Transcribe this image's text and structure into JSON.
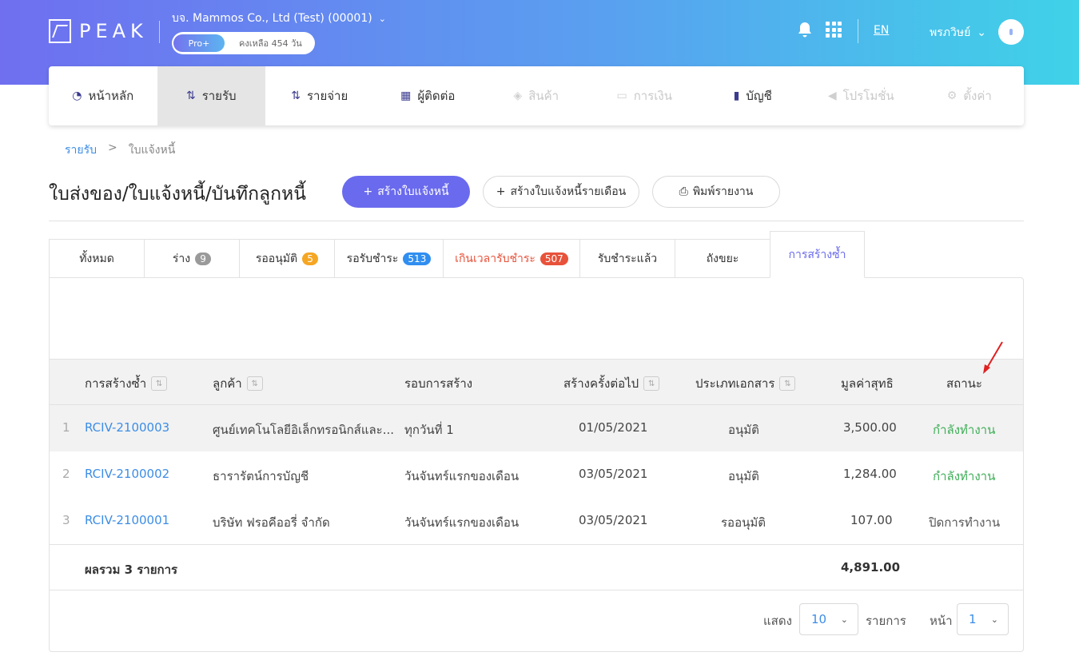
{
  "header": {
    "logo": "PEAK",
    "company": "บจ. Mammos Co., Ltd (Test) (00001)",
    "plan_badge": "Pro+",
    "plan_remaining": "คงเหลือ 454 วัน",
    "lang": "EN",
    "user": "พรภวิษย์"
  },
  "nav": [
    {
      "label": "หน้าหลัก",
      "icon": "dashboard-icon"
    },
    {
      "label": "รายรับ",
      "icon": "income-icon"
    },
    {
      "label": "รายจ่าย",
      "icon": "expense-icon"
    },
    {
      "label": "ผู้ติดต่อ",
      "icon": "contacts-icon"
    },
    {
      "label": "สินค้า",
      "icon": "product-icon"
    },
    {
      "label": "การเงิน",
      "icon": "money-icon"
    },
    {
      "label": "บัญชี",
      "icon": "ledger-icon"
    },
    {
      "label": "โปรโมชั่น",
      "icon": "promotion-icon"
    },
    {
      "label": "ตั้งค่า",
      "icon": "gear-icon"
    }
  ],
  "breadcrumb": {
    "parent": "รายรับ",
    "sep": ">",
    "current": "ใบแจ้งหนี้"
  },
  "page": {
    "title": "ใบส่งของ/ใบแจ้งหนี้/บันทึกลูกหนี้",
    "create_button": "สร้างใบแจ้งหนี้",
    "monthly_button": "สร้างใบแจ้งหนี้รายเดือน",
    "print_button": "พิมพ์รายงาน"
  },
  "tabs": [
    {
      "label": "ทั้งหมด"
    },
    {
      "label": "ร่าง",
      "count": "9"
    },
    {
      "label": "รออนุมัติ",
      "count": "5"
    },
    {
      "label": "รอรับชำระ",
      "count": "513"
    },
    {
      "label": "เกินเวลารับชำระ",
      "count": "507"
    },
    {
      "label": "รับชำระแล้ว"
    },
    {
      "label": "ถังขยะ"
    },
    {
      "label": "การสร้างซ้ำ"
    }
  ],
  "table": {
    "headers": [
      "การสร้างซ้ำ",
      "ลูกค้า",
      "รอบการสร้าง",
      "สร้างครั้งต่อไป",
      "ประเภทเอกสาร",
      "มูลค่าสุทธิ",
      "สถานะ"
    ],
    "rows": [
      {
        "no": "1",
        "doc": "RCIV-2100003",
        "customer": "ศูนย์เทคโนโลยีอิเล็กทรอนิกส์และ...",
        "cycle": "ทุกวันที่ 1",
        "next": "01/05/2021",
        "type": "อนุมัติ",
        "amount": "3,500.00",
        "status": "กำลังทำงาน"
      },
      {
        "no": "2",
        "doc": "RCIV-2100002",
        "customer": "ธารารัตน์การบัญชี",
        "cycle": "วันจันทร์แรกของเดือน",
        "next": "03/05/2021",
        "type": "อนุมัติ",
        "amount": "1,284.00",
        "status": "กำลังทำงาน"
      },
      {
        "no": "3",
        "doc": "RCIV-2100001",
        "customer": "บริษัท ฟรอคีออรี่ จำกัด",
        "cycle": "วันจันทร์แรกของเดือน",
        "next": "03/05/2021",
        "type": "รออนุมัติ",
        "amount": "107.00",
        "status": "ปิดการทำงาน"
      }
    ],
    "total_label": "ผลรวม 3 รายการ",
    "total_amount": "4,891.00"
  },
  "pagination": {
    "show_label": "แสดง",
    "page_size": "10",
    "items_label": "รายการ",
    "page_label": "หน้า",
    "page": "1"
  },
  "colors": {
    "primary": "#6a6aee",
    "link": "#3c8de6",
    "active_status": "#3fae58",
    "overdue": "#e8523a"
  }
}
